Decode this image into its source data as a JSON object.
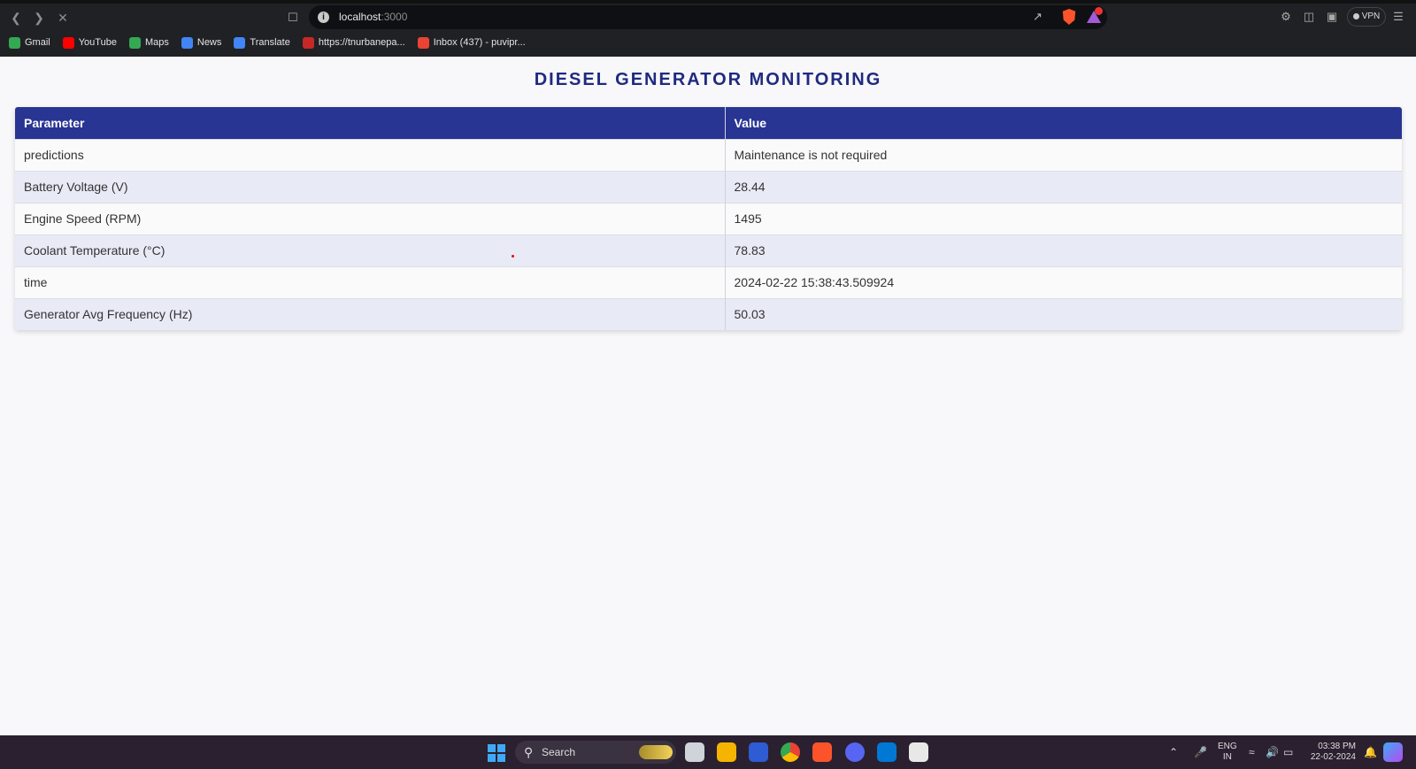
{
  "browser": {
    "url_host": "localhost",
    "url_port": ":3000",
    "vpn_label": "VPN",
    "bookmarks": [
      {
        "label": "Gmail",
        "color": "#34a853"
      },
      {
        "label": "YouTube",
        "color": "#ff0000"
      },
      {
        "label": "Maps",
        "color": "#34a853"
      },
      {
        "label": "News",
        "color": "#4285f4"
      },
      {
        "label": "Translate",
        "color": "#4285f4"
      },
      {
        "label": "https://tnurbanepa...",
        "color": "#c62828"
      },
      {
        "label": "Inbox (437) - puvipr...",
        "color": "#ea4335"
      }
    ]
  },
  "page": {
    "title": "DIESEL GENERATOR MONITORING",
    "table": {
      "headers": [
        "Parameter",
        "Value"
      ],
      "rows": [
        [
          "predictions",
          "Maintenance is not required"
        ],
        [
          "Battery Voltage (V)",
          "28.44"
        ],
        [
          "Engine Speed (RPM)",
          "1495"
        ],
        [
          "Coolant Temperature (°C)",
          "78.83"
        ],
        [
          "time",
          "2024-02-22 15:38:43.509924"
        ],
        [
          "Generator Avg Frequency (Hz)",
          "50.03"
        ]
      ]
    }
  },
  "taskbar": {
    "search_label": "Search",
    "lang_top": "ENG",
    "lang_bottom": "IN",
    "time": "03:38 PM",
    "date": "22-02-2024"
  }
}
